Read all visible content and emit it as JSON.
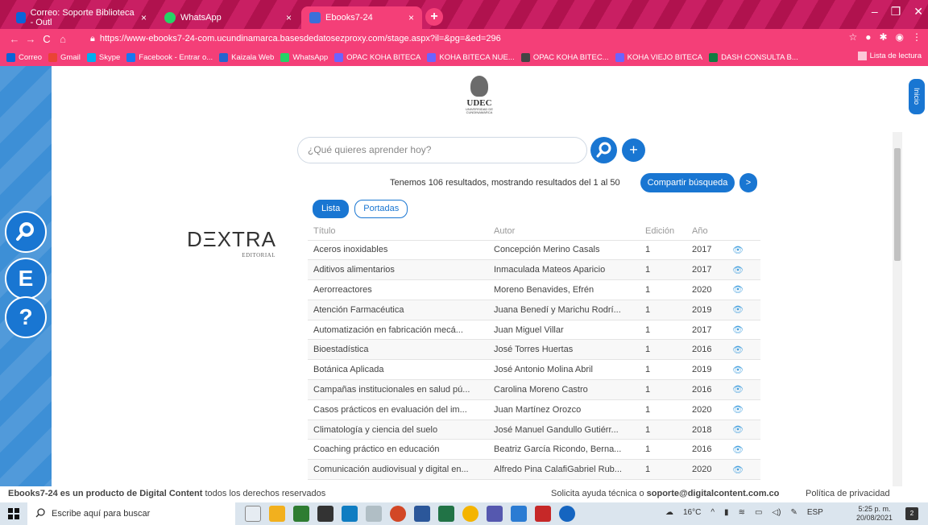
{
  "tabs": [
    {
      "label": "Correo: Soporte Biblioteca - Outl",
      "close": "×",
      "color": "#0a64d8"
    },
    {
      "label": "WhatsApp",
      "close": "×",
      "color": "#25d366"
    },
    {
      "label": "Ebooks7-24",
      "close": "×",
      "color": "#3b6fd9"
    }
  ],
  "new_tab": "+",
  "url": "https://www-ebooks7-24-com.ucundinamarca.basesdedatosezproxy.com/stage.aspx?il=&pg=&ed=296",
  "bookmarks": [
    {
      "label": "Correo",
      "color": "#0a64d8"
    },
    {
      "label": "Gmail",
      "color": "#ea4335"
    },
    {
      "label": "Skype",
      "color": "#00aff0"
    },
    {
      "label": "Facebook - Entrar o...",
      "color": "#1877f2"
    },
    {
      "label": "Kaizala Web",
      "color": "#2564cf"
    },
    {
      "label": "WhatsApp",
      "color": "#25d366"
    },
    {
      "label": "OPAC KOHA BITECA",
      "color": "#6c63ff"
    },
    {
      "label": "KOHA BITECA NUE...",
      "color": "#6c63ff"
    },
    {
      "label": "OPAC KOHA BITEC...",
      "color": "#444"
    },
    {
      "label": "KOHA VIEJO BITECA",
      "color": "#6c63ff"
    },
    {
      "label": "DASH CONSULTA B...",
      "color": "#107c41"
    }
  ],
  "reading_list": "Lista de lectura",
  "sidebar": {
    "search": "⌕",
    "e_button": "E",
    "help": "?"
  },
  "logo": {
    "name": "UDEC",
    "sub": "UNIVERSIDAD DE CUNDINAMARCA"
  },
  "publisher": {
    "name": "DΞXTRA",
    "sub": "EDITORIAL"
  },
  "search_placeholder": "¿Qué quieres aprender hoy?",
  "plus": "+",
  "results_text": "Tenemos 106 resultados, mostrando resultados del 1 al 50",
  "share_label": "Compartir búsqueda",
  "next_label": ">",
  "view_tabs": {
    "list": "Lista",
    "covers": "Portadas"
  },
  "inicio": "Inicio",
  "table": {
    "headers": [
      "Título",
      "Autor",
      "Edición",
      "Año"
    ],
    "rows": [
      [
        "Aceros inoxidables",
        "Concepción Merino Casals",
        "1",
        "2017"
      ],
      [
        "Aditivos alimentarios",
        "Inmaculada Mateos Aparicio",
        "1",
        "2017"
      ],
      [
        "Aerorreactores",
        "Moreno Benavides, Efrén",
        "1",
        "2020"
      ],
      [
        "Atención Farmacéutica",
        "Juana Benedí y Marichu Rodrí...",
        "1",
        "2019"
      ],
      [
        "Automatización en fabricación mecá...",
        "Juan Miguel Villar",
        "1",
        "2017"
      ],
      [
        "Bioestadística",
        "José Torres Huertas",
        "1",
        "2016"
      ],
      [
        "Botánica Aplicada",
        "José Antonio Molina Abril",
        "1",
        "2019"
      ],
      [
        "Campañas institucionales en salud pú...",
        "Carolina Moreno Castro",
        "1",
        "2016"
      ],
      [
        "Casos prácticos en evaluación del im...",
        "Juan Martínez Orozco",
        "1",
        "2020"
      ],
      [
        "Climatología y ciencia del suelo",
        "José Manuel Gandullo Gutiérr...",
        "1",
        "2018"
      ],
      [
        "Coaching práctico en educación",
        "Beatriz García Ricondo, Berna...",
        "1",
        "2016"
      ],
      [
        "Comunicación audiovisual y digital en...",
        "Alfredo Pina CalafiGabriel Rub...",
        "1",
        "2020"
      ]
    ]
  },
  "footer": {
    "left_bold": "Ebooks7-24 es un producto de Digital Content",
    "left_rest": " todos los derechos reservados",
    "help_prefix": "Solicita ayuda técnica o ",
    "help_email": "soporte@digitalcontent.com.co",
    "privacy": "Política de privacidad"
  },
  "taskbar": {
    "search_placeholder": "Escribe aquí para buscar",
    "temperature": "16°C",
    "lang": "ESP",
    "time": "5:25 p. m.",
    "date": "20/08/2021",
    "notifications": "2"
  }
}
